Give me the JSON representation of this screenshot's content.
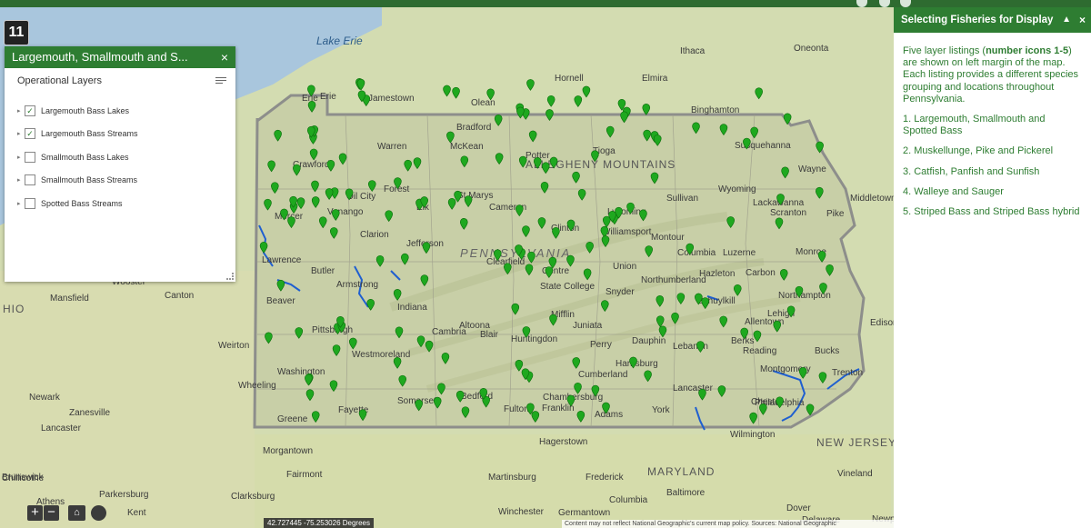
{
  "topbar": {
    "bg": "#2e6b30"
  },
  "app_button": {
    "label": "11",
    "icon": "app-logo-icon"
  },
  "layer_panel": {
    "title": "Largemouth, Smallmouth and S...",
    "close_label": "×",
    "subtitle": "Operational Layers",
    "layers": [
      {
        "label": "Largemouth Bass Lakes",
        "checked": true
      },
      {
        "label": "Largemouth Bass Streams",
        "checked": true
      },
      {
        "label": "Smallmouth Bass Lakes",
        "checked": false
      },
      {
        "label": "Smallmouth Bass Streams",
        "checked": false
      },
      {
        "label": "Spotted Bass Streams",
        "checked": false
      }
    ]
  },
  "side_panel": {
    "title": "Selecting Fisheries for Display",
    "collapse_label": "▲",
    "close_label": "×",
    "intro_pre": "Five layer listings (",
    "intro_bold": "number icons 1-5",
    "intro_post": ") are shown on left margin of the map. Each listing provides a different species grouping and locations throughout Pennsylvania.",
    "items": [
      "1. Largemouth, Smallmouth and Spotted Bass",
      "2. Muskellunge, Pike and Pickerel",
      "3. Catfish, Panfish and Sunfish",
      "4. Walleye and  Sauger",
      "5. Striped Bass and Striped Bass hybrid"
    ],
    "text_color": "#2e7d32",
    "header_color": "#2e7d32"
  },
  "map": {
    "coords": "42.727445 -75.253026 Degrees",
    "attribution": "Content may not reflect National Geographic's current map policy. Sources: National Geographic",
    "labels": [
      {
        "text": "Lake Erie",
        "cls": "water"
      },
      {
        "text": "Jamestown"
      },
      {
        "text": "Olean"
      },
      {
        "text": "Hornell"
      },
      {
        "text": "Ithaca"
      },
      {
        "text": "Elmira"
      },
      {
        "text": "Binghamton"
      },
      {
        "text": "Oneonta"
      },
      {
        "text": "Bradford"
      },
      {
        "text": "Warren"
      },
      {
        "text": "McKean"
      },
      {
        "text": "Potter"
      },
      {
        "text": "Tioga"
      },
      {
        "text": "Susquehanna"
      },
      {
        "text": "Wayne"
      },
      {
        "text": "Crawford"
      },
      {
        "text": "Erie"
      },
      {
        "text": "Forest"
      },
      {
        "text": "Elk"
      },
      {
        "text": "Cameron"
      },
      {
        "text": "Lycoming"
      },
      {
        "text": "Sullivan"
      },
      {
        "text": "Wyoming"
      },
      {
        "text": "Lackawanna"
      },
      {
        "text": "Pike"
      },
      {
        "text": "Mercer"
      },
      {
        "text": "Venango"
      },
      {
        "text": "Clarion"
      },
      {
        "text": "Jefferson"
      },
      {
        "text": "Clearfield"
      },
      {
        "text": "Clinton"
      },
      {
        "text": "Williamsport"
      },
      {
        "text": "Montour"
      },
      {
        "text": "Columbia"
      },
      {
        "text": "Luzerne"
      },
      {
        "text": "Monroe"
      },
      {
        "text": "Lawrence"
      },
      {
        "text": "Butler"
      },
      {
        "text": "Armstrong"
      },
      {
        "text": "Indiana"
      },
      {
        "text": "Centre"
      },
      {
        "text": "Union"
      },
      {
        "text": "Northumberland"
      },
      {
        "text": "Carbon"
      },
      {
        "text": "Northampton"
      },
      {
        "text": "Beaver"
      },
      {
        "text": "Pittsburgh"
      },
      {
        "text": "Westmoreland"
      },
      {
        "text": "Cambria"
      },
      {
        "text": "Altoona"
      },
      {
        "text": "Huntingdon"
      },
      {
        "text": "Mifflin"
      },
      {
        "text": "Juniata"
      },
      {
        "text": "Snyder"
      },
      {
        "text": "State College"
      },
      {
        "text": "Dauphin"
      },
      {
        "text": "Lebanon"
      },
      {
        "text": "Berks"
      },
      {
        "text": "Lehigh"
      },
      {
        "text": "Bucks"
      },
      {
        "text": "Allentown"
      },
      {
        "text": "Washington"
      },
      {
        "text": "Somerset"
      },
      {
        "text": "Bedford"
      },
      {
        "text": "Blair"
      },
      {
        "text": "Perry"
      },
      {
        "text": "Harrisburg"
      },
      {
        "text": "Cumberland"
      },
      {
        "text": "Lancaster"
      },
      {
        "text": "Chester"
      },
      {
        "text": "Montgomery"
      },
      {
        "text": "Philadelphia"
      },
      {
        "text": "Greene"
      },
      {
        "text": "Fayette"
      },
      {
        "text": "Fulton"
      },
      {
        "text": "Franklin"
      },
      {
        "text": "Chambersburg"
      },
      {
        "text": "Adams"
      },
      {
        "text": "York"
      },
      {
        "text": "Wilmington"
      },
      {
        "text": "Trenton"
      },
      {
        "text": "Hagerstown"
      },
      {
        "text": "Martinsburg"
      },
      {
        "text": "Frederick"
      },
      {
        "text": "MARYLAND",
        "cls": "big"
      },
      {
        "text": "NEW JERSEY",
        "cls": "big"
      },
      {
        "text": "Baltimore"
      },
      {
        "text": "Columbia"
      },
      {
        "text": "Germantown"
      },
      {
        "text": "Winchester"
      },
      {
        "text": "Morgantown"
      },
      {
        "text": "Fairmont"
      },
      {
        "text": "Clarksburg"
      },
      {
        "text": "Parkersburg"
      },
      {
        "text": "Chillicothe"
      },
      {
        "text": "Athens"
      },
      {
        "text": "Zanesville"
      },
      {
        "text": "Newark"
      },
      {
        "text": "Lancaster"
      },
      {
        "text": "Mansfield"
      },
      {
        "text": "Wooster"
      },
      {
        "text": "Canton"
      },
      {
        "text": "Weirton"
      },
      {
        "text": "Wheeling"
      },
      {
        "text": "HIO",
        "cls": "big"
      },
      {
        "text": "PENNSYLVANIA",
        "cls": "state"
      },
      {
        "text": "ALLEGHENY MOUNTAINS",
        "cls": "big"
      },
      {
        "text": "Oil City"
      },
      {
        "text": "St Marys"
      },
      {
        "text": "Middletown"
      },
      {
        "text": "Scranton"
      },
      {
        "text": "Hazleton"
      },
      {
        "text": "Schuylkill"
      },
      {
        "text": "Reading"
      },
      {
        "text": "Edison"
      },
      {
        "text": "Vineland"
      },
      {
        "text": "Dover"
      },
      {
        "text": "Delaware"
      },
      {
        "text": "Newport"
      },
      {
        "text": "Brunswick"
      },
      {
        "text": "Erie"
      },
      {
        "text": "Kent"
      }
    ],
    "marker_count": 190,
    "marker_color": "#1fa81f"
  }
}
